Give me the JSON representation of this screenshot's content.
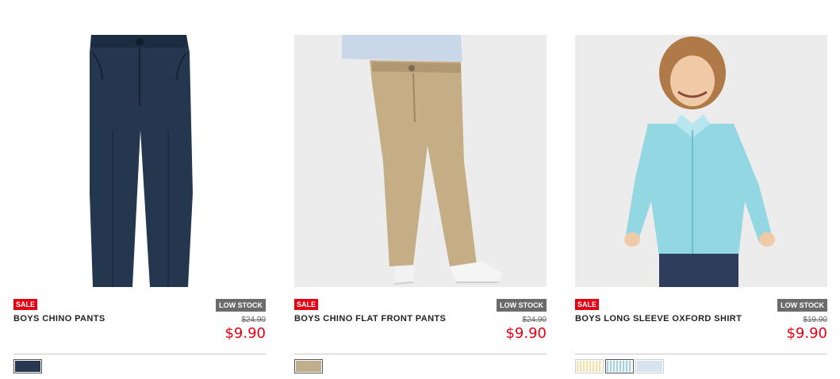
{
  "products": [
    {
      "sale_badge": "SALE",
      "stock_badge": "LOW STOCK",
      "name": "BOYS CHINO PANTS",
      "original_price": "$24.90",
      "sale_price": "$9.90",
      "image_icon": "navy-chino-pants-image",
      "swatches": [
        {
          "color": "#27374f",
          "selected": true
        }
      ]
    },
    {
      "sale_badge": "SALE",
      "stock_badge": "LOW STOCK",
      "name": "BOYS CHINO FLAT FRONT PANTS",
      "original_price": "$24.90",
      "sale_price": "$9.90",
      "image_icon": "khaki-chino-pants-image",
      "swatches": [
        {
          "color": "#c2ad8c",
          "selected": true
        }
      ]
    },
    {
      "sale_badge": "SALE",
      "stock_badge": "LOW STOCK",
      "name": "BOYS LONG SLEEVE OXFORD SHIRT",
      "original_price": "$19.90",
      "sale_price": "$9.90",
      "image_icon": "boy-oxford-shirt-image",
      "swatches": [
        {
          "color": "#efe3b6",
          "selected": false
        },
        {
          "color": "#a9cfdc",
          "selected": true
        },
        {
          "color": "#d7e3ee",
          "selected": false
        }
      ]
    }
  ]
}
